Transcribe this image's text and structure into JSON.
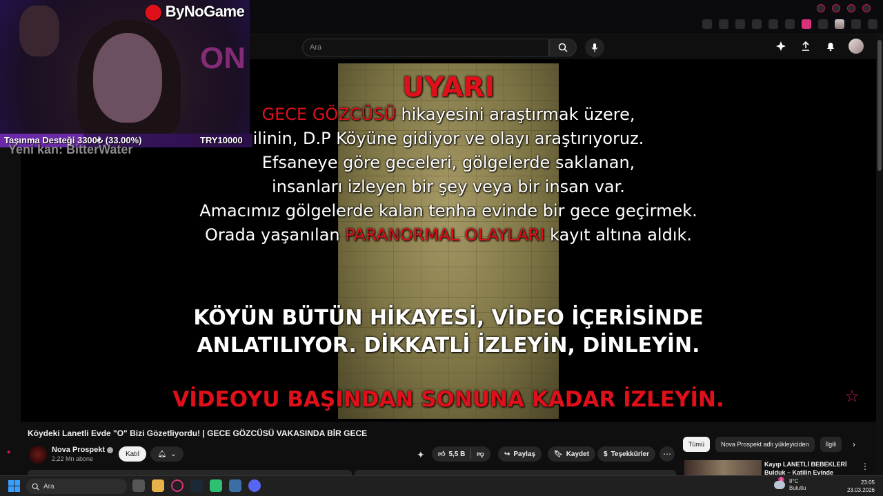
{
  "stream_overlay": {
    "brand": "ByNoGame",
    "donation_label": "Taşınma Desteği 3300₺ (33.00%)",
    "donation_goal": "TRY10000",
    "donation_progress": 0.33,
    "new_subscriber": "Yeni kan: BitterWater"
  },
  "masthead": {
    "search_placeholder": "Ara"
  },
  "video_overlay": {
    "warning": "UYARI",
    "line1_red": "GECE GÖZCÜSÜ",
    "line1_rest": " hikayesini araştırmak üzere,",
    "line2": "ilinin, D.P Köyüne gidiyor ve olayı araştırıyoruz.",
    "line3": "Efsaneye göre geceleri, gölgelerde saklanan,",
    "line4": "insanları izleyen bir şey veya bir insan var.",
    "line5": "Amacımız gölgelerde kalan tenha evinde bir gece geçirmek.",
    "line6_a": "Orada yaşanılan ",
    "line6_red": "PARANORMAL OLAYLARI",
    "line6_b": " kayıt altına aldık.",
    "big1": "KÖYÜN BÜTÜN HİKAYESİ, VİDEO İÇERİSİNDE",
    "big2": "ANLATILIYOR. DİKKATLİ İZLEYİN, DİNLEYİN.",
    "red_footer": "VİDEOYU BAŞINDAN SONUNA KADAR İZLEYİN."
  },
  "video_info": {
    "title": "Köydeki Lanetli Evde \"O\" Bizi Gözetliyordu! | GECE GÖZCÜSÜ VAKASINDA BİR GECE",
    "channel_name": "Nova Prospekt",
    "subscribers": "2,22 Mn abone",
    "join_label": "Katıl",
    "likes": "5,5 B",
    "share_label": "Paylaş",
    "save_label": "Kaydet",
    "thanks_label": "Teşekkürler"
  },
  "chips": [
    "Tümü",
    "Nova Prospekt adlı yükleyiciden",
    "İlgili"
  ],
  "recommendation": {
    "title": "Kayıp LANETLİ BEBEKLERİ Bulduk – Katilin Evinde Korkun..."
  },
  "taskbar": {
    "search_label": "Ara",
    "temperature": "8°C",
    "weather": "Bulutlu",
    "time": "23:05",
    "date": "23.03.2026",
    "notification_count": "3"
  },
  "colors": {
    "accent_red": "#e0101a",
    "accent_pink": "#d8327a",
    "progress_purple": "#6a2aa8"
  }
}
